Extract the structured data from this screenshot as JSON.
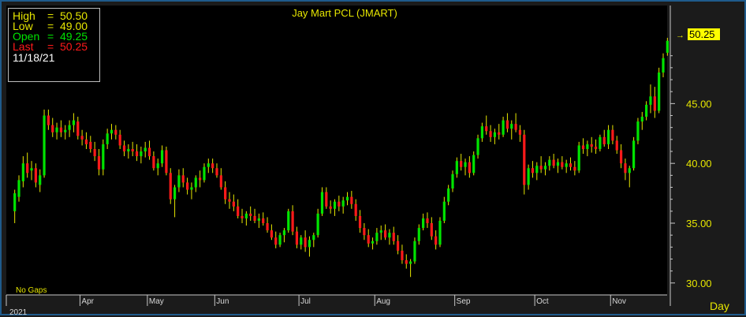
{
  "chart_data": {
    "type": "candlestick",
    "title": "Jay Mart PCL (JMART)",
    "footer_note": "No Gaps",
    "period_label": "Day",
    "year_label": "2021",
    "last_price_tag": "50.25",
    "ylim": [
      29.0,
      53.2
    ],
    "yticks": [
      "30.00",
      "35.00",
      "40.00",
      "45.00"
    ],
    "months": [
      "Apr",
      "May",
      "Jun",
      "Jul",
      "Aug",
      "Sep",
      "Oct",
      "Nov"
    ],
    "month_start_index": [
      16,
      32,
      48,
      68,
      86,
      105,
      124,
      142
    ],
    "colors": {
      "up": "#00e400",
      "down": "#ff1a1a",
      "wick": "#e6e600",
      "axis": "#c8c8c8",
      "panel": "#000000"
    },
    "info": {
      "high_label": "High",
      "high_value": "50.50",
      "low_label": "Low",
      "low_value": "49.00",
      "open_label": "Open",
      "open_value": "49.25",
      "last_label": "Last",
      "last_value": "50.25",
      "date": "11/18/21"
    },
    "ohlc": [
      [
        36.0,
        37.8,
        35.0,
        37.5
      ],
      [
        37.2,
        39.0,
        36.8,
        38.6
      ],
      [
        38.5,
        40.6,
        38.0,
        40.0
      ],
      [
        40.0,
        40.9,
        38.8,
        39.2
      ],
      [
        39.4,
        40.2,
        38.6,
        39.6
      ],
      [
        39.6,
        40.0,
        38.0,
        38.4
      ],
      [
        38.2,
        39.5,
        37.6,
        39.0
      ],
      [
        39.0,
        44.5,
        38.8,
        44.0
      ],
      [
        44.0,
        44.5,
        42.8,
        43.2
      ],
      [
        43.2,
        43.8,
        42.2,
        42.6
      ],
      [
        42.6,
        43.4,
        42.0,
        43.0
      ],
      [
        43.0,
        43.6,
        42.2,
        42.6
      ],
      [
        42.6,
        43.2,
        42.0,
        42.8
      ],
      [
        42.8,
        43.6,
        42.2,
        43.2
      ],
      [
        43.2,
        44.2,
        42.6,
        43.6
      ],
      [
        43.5,
        43.9,
        42.0,
        42.3
      ],
      [
        42.3,
        42.8,
        41.5,
        42.0
      ],
      [
        42.0,
        42.6,
        41.2,
        41.6
      ],
      [
        41.8,
        42.3,
        40.9,
        41.2
      ],
      [
        41.2,
        41.8,
        40.2,
        40.6
      ],
      [
        40.6,
        41.2,
        39.0,
        39.5
      ],
      [
        39.5,
        42.0,
        39.0,
        41.6
      ],
      [
        41.6,
        42.9,
        41.2,
        42.5
      ],
      [
        42.5,
        43.3,
        42.0,
        42.8
      ],
      [
        42.8,
        43.2,
        42.0,
        42.4
      ],
      [
        42.4,
        42.8,
        41.2,
        41.5
      ],
      [
        41.5,
        41.9,
        40.6,
        41.0
      ],
      [
        41.0,
        41.6,
        40.4,
        41.2
      ],
      [
        41.2,
        41.8,
        40.6,
        41.0
      ],
      [
        41.0,
        41.6,
        40.2,
        40.6
      ],
      [
        40.6,
        41.4,
        40.0,
        41.0
      ],
      [
        41.0,
        41.8,
        40.5,
        41.3
      ],
      [
        41.3,
        41.9,
        40.3,
        40.6
      ],
      [
        40.6,
        41.0,
        39.4,
        39.6
      ],
      [
        39.6,
        40.4,
        39.0,
        40.0
      ],
      [
        40.0,
        41.5,
        39.7,
        41.1
      ],
      [
        41.1,
        41.4,
        39.0,
        39.2
      ],
      [
        39.2,
        39.6,
        36.6,
        37.0
      ],
      [
        37.0,
        38.2,
        35.5,
        38.0
      ],
      [
        38.0,
        39.5,
        37.6,
        39.0
      ],
      [
        39.0,
        39.6,
        38.0,
        38.4
      ],
      [
        38.4,
        38.8,
        37.4,
        37.8
      ],
      [
        37.8,
        38.4,
        37.0,
        38.0
      ],
      [
        38.0,
        39.0,
        37.6,
        38.8
      ],
      [
        38.8,
        39.4,
        38.0,
        38.6
      ],
      [
        38.6,
        40.0,
        38.4,
        39.7
      ],
      [
        39.7,
        40.4,
        39.2,
        40.0
      ],
      [
        40.0,
        40.4,
        39.2,
        39.6
      ],
      [
        39.6,
        40.0,
        38.8,
        39.0
      ],
      [
        39.0,
        39.6,
        37.8,
        38.0
      ],
      [
        38.0,
        38.5,
        36.6,
        37.0
      ],
      [
        37.0,
        37.6,
        36.2,
        36.8
      ],
      [
        36.8,
        37.4,
        36.0,
        36.4
      ],
      [
        36.4,
        37.0,
        35.4,
        35.6
      ],
      [
        35.6,
        36.2,
        35.0,
        35.4
      ],
      [
        35.4,
        36.0,
        34.8,
        35.8
      ],
      [
        35.8,
        36.4,
        35.2,
        35.6
      ],
      [
        35.6,
        36.2,
        35.0,
        35.2
      ],
      [
        35.2,
        35.8,
        34.6,
        35.4
      ],
      [
        35.4,
        35.9,
        34.8,
        35.0
      ],
      [
        35.0,
        35.5,
        34.2,
        34.4
      ],
      [
        34.4,
        34.9,
        33.6,
        33.8
      ],
      [
        33.8,
        34.3,
        32.9,
        33.2
      ],
      [
        33.2,
        34.2,
        33.0,
        34.0
      ],
      [
        34.0,
        34.6,
        33.4,
        34.4
      ],
      [
        34.4,
        36.2,
        34.2,
        36.0
      ],
      [
        36.0,
        36.5,
        34.0,
        34.3
      ],
      [
        34.3,
        34.7,
        32.9,
        33.2
      ],
      [
        33.2,
        34.0,
        32.8,
        33.8
      ],
      [
        33.8,
        34.4,
        32.6,
        33.0
      ],
      [
        33.0,
        33.9,
        32.2,
        33.6
      ],
      [
        33.6,
        34.2,
        33.0,
        34.0
      ],
      [
        34.0,
        36.2,
        33.8,
        35.8
      ],
      [
        35.8,
        38.0,
        35.6,
        37.6
      ],
      [
        37.6,
        38.0,
        36.2,
        36.4
      ],
      [
        36.4,
        36.9,
        35.8,
        36.2
      ],
      [
        36.2,
        37.0,
        35.6,
        36.8
      ],
      [
        36.8,
        37.3,
        36.0,
        36.4
      ],
      [
        36.4,
        37.2,
        35.8,
        36.9
      ],
      [
        36.9,
        37.6,
        36.5,
        37.2
      ],
      [
        37.2,
        37.7,
        36.2,
        36.6
      ],
      [
        36.6,
        37.0,
        35.2,
        35.6
      ],
      [
        35.6,
        36.1,
        34.2,
        34.6
      ],
      [
        34.6,
        35.0,
        33.6,
        34.0
      ],
      [
        34.0,
        34.5,
        33.0,
        33.3
      ],
      [
        33.3,
        33.8,
        32.8,
        33.5
      ],
      [
        33.5,
        34.6,
        33.2,
        34.2
      ],
      [
        34.2,
        34.8,
        33.6,
        34.4
      ],
      [
        34.4,
        34.9,
        33.6,
        33.8
      ],
      [
        33.8,
        34.5,
        33.2,
        34.2
      ],
      [
        34.2,
        34.7,
        33.2,
        33.5
      ],
      [
        33.5,
        34.0,
        32.4,
        32.7
      ],
      [
        32.7,
        33.2,
        31.6,
        31.9
      ],
      [
        31.9,
        32.4,
        31.2,
        31.6
      ],
      [
        31.6,
        32.0,
        30.5,
        31.8
      ],
      [
        31.8,
        33.8,
        31.6,
        33.5
      ],
      [
        33.5,
        34.9,
        33.2,
        34.6
      ],
      [
        34.6,
        35.8,
        34.4,
        35.4
      ],
      [
        35.4,
        35.9,
        34.6,
        35.0
      ],
      [
        35.0,
        35.5,
        33.6,
        33.9
      ],
      [
        33.9,
        34.4,
        32.8,
        33.2
      ],
      [
        33.2,
        35.5,
        33.0,
        35.2
      ],
      [
        35.2,
        37.2,
        35.0,
        36.8
      ],
      [
        36.8,
        38.2,
        36.5,
        37.9
      ],
      [
        37.9,
        39.4,
        37.6,
        39.1
      ],
      [
        39.1,
        40.5,
        38.8,
        40.2
      ],
      [
        40.2,
        40.8,
        39.4,
        39.7
      ],
      [
        39.7,
        40.4,
        39.0,
        40.1
      ],
      [
        40.1,
        40.6,
        38.8,
        39.2
      ],
      [
        39.2,
        41.0,
        39.0,
        40.7
      ],
      [
        40.7,
        42.4,
        40.4,
        42.1
      ],
      [
        42.1,
        43.4,
        41.8,
        43.1
      ],
      [
        43.1,
        44.0,
        42.4,
        42.7
      ],
      [
        42.7,
        43.2,
        41.8,
        42.2
      ],
      [
        42.2,
        42.9,
        41.6,
        42.6
      ],
      [
        42.6,
        43.3,
        42.0,
        42.4
      ],
      [
        42.4,
        43.9,
        42.2,
        43.6
      ],
      [
        43.6,
        44.2,
        42.6,
        42.9
      ],
      [
        42.9,
        43.6,
        42.0,
        43.3
      ],
      [
        43.3,
        44.2,
        42.6,
        42.8
      ],
      [
        42.8,
        43.2,
        41.8,
        42.4
      ],
      [
        42.4,
        42.8,
        37.4,
        38.2
      ],
      [
        38.2,
        39.9,
        37.8,
        39.6
      ],
      [
        39.6,
        40.2,
        38.8,
        39.2
      ],
      [
        39.2,
        40.1,
        38.6,
        39.8
      ],
      [
        39.8,
        40.6,
        39.2,
        39.5
      ],
      [
        39.5,
        40.1,
        39.0,
        39.8
      ],
      [
        39.8,
        40.6,
        39.4,
        40.3
      ],
      [
        40.3,
        40.8,
        39.6,
        39.8
      ],
      [
        39.8,
        40.4,
        39.2,
        40.1
      ],
      [
        40.1,
        40.6,
        39.5,
        39.7
      ],
      [
        39.7,
        40.3,
        39.2,
        40.0
      ],
      [
        40.0,
        40.5,
        39.4,
        39.7
      ],
      [
        39.7,
        40.2,
        39.0,
        39.4
      ],
      [
        39.4,
        41.8,
        39.2,
        41.5
      ],
      [
        41.5,
        42.1,
        40.8,
        41.2
      ],
      [
        41.2,
        41.9,
        40.6,
        41.6
      ],
      [
        41.6,
        42.2,
        40.9,
        41.4
      ],
      [
        41.4,
        42.0,
        40.8,
        41.2
      ],
      [
        41.2,
        42.4,
        41.0,
        42.2
      ],
      [
        42.2,
        42.8,
        41.4,
        41.6
      ],
      [
        41.6,
        43.2,
        41.2,
        42.8
      ],
      [
        42.8,
        43.2,
        41.6,
        41.9
      ],
      [
        41.9,
        42.3,
        40.8,
        41.1
      ],
      [
        41.1,
        41.6,
        39.6,
        40.0
      ],
      [
        40.0,
        40.4,
        38.6,
        39.2
      ],
      [
        39.2,
        39.8,
        38.0,
        39.6
      ],
      [
        39.6,
        42.2,
        39.4,
        41.9
      ],
      [
        41.9,
        43.8,
        41.6,
        43.5
      ],
      [
        43.5,
        44.3,
        42.8,
        43.9
      ],
      [
        43.9,
        45.2,
        43.6,
        44.9
      ],
      [
        44.9,
        46.6,
        44.2,
        45.6
      ],
      [
        45.6,
        46.4,
        43.8,
        44.4
      ],
      [
        44.4,
        48.0,
        44.2,
        47.6
      ],
      [
        47.6,
        49.2,
        47.2,
        48.8
      ],
      [
        49.25,
        50.5,
        49.0,
        50.25
      ]
    ]
  }
}
